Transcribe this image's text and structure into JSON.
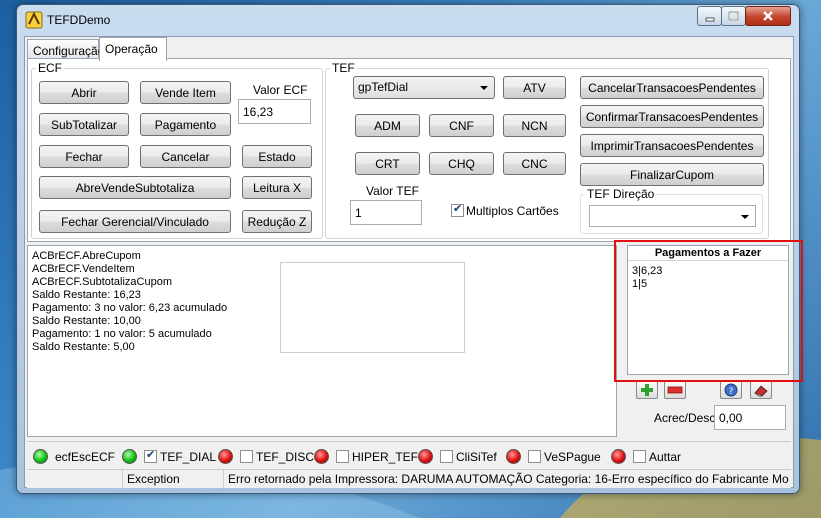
{
  "window": {
    "title": "TEFDDemo"
  },
  "tabs": [
    {
      "label": "Configuração"
    },
    {
      "label": "Operação"
    }
  ],
  "ecf": {
    "group_label": "ECF",
    "buttons": {
      "abrir": "Abrir",
      "vende_item": "Vende Item",
      "subtotalizar": "SubTotalizar",
      "pagamento": "Pagamento",
      "fechar": "Fechar",
      "cancelar": "Cancelar",
      "estado": "Estado",
      "abre_vende_subtotaliza": "AbreVendeSubtotaliza",
      "leitura_x": "Leitura X",
      "fechar_gerencial": "Fechar Gerencial/Vinculado",
      "reducao_z": "Redução Z"
    },
    "valor_label": "Valor ECF",
    "valor_value": "16,23"
  },
  "tef": {
    "group_label": "TEF",
    "gp_selected": "gpTefDial",
    "buttons": {
      "atv": "ATV",
      "adm": "ADM",
      "cnf": "CNF",
      "ncn": "NCN",
      "crt": "CRT",
      "chq": "CHQ",
      "cnc": "CNC",
      "cancelar_pendentes": "CancelarTransacoesPendentes",
      "confirmar_pendentes": "ConfirmarTransacoesPendentes",
      "imprimir_pendentes": "ImprimirTransacoesPendentes",
      "finalizar_cupom": "FinalizarCupom"
    },
    "valor_label": "Valor TEF",
    "valor_value": "1",
    "multiplos_label": "Multiplos Cartões",
    "multiplos_checked": true,
    "direcao_label": "TEF Direção",
    "direcao_value": ""
  },
  "log": {
    "lines": [
      "ACBrECF.AbreCupom",
      "ACBrECF.VendeItem",
      "ACBrECF.SubtotalizaCupom",
      "Saldo Restante: 16,23",
      "Pagamento: 3 no valor: 6,23 acumulado",
      "Saldo Restante: 10,00",
      "Pagamento: 1 no valor: 5 acumulado",
      "Saldo Restante: 5,00"
    ]
  },
  "pagamentos": {
    "header": "Pagamentos a Fazer",
    "items": [
      "3|6,23",
      "1|5"
    ],
    "acrec_label": "Acrec/Desc",
    "acrec_value": "0,00"
  },
  "status_indicators": [
    {
      "label": "ecfEscECF",
      "status": "green",
      "has_checkbox": false,
      "checked": false
    },
    {
      "label": "TEF_DIAL",
      "status": "green",
      "has_checkbox": true,
      "checked": true
    },
    {
      "label": "TEF_DISC",
      "status": "red",
      "has_checkbox": true,
      "checked": false
    },
    {
      "label": "HIPER_TEF",
      "status": "red",
      "has_checkbox": true,
      "checked": false
    },
    {
      "label": "CliSiTef",
      "status": "red",
      "has_checkbox": true,
      "checked": false
    },
    {
      "label": "VeSPague",
      "status": "red",
      "has_checkbox": true,
      "checked": false
    },
    {
      "label": "Auttar",
      "status": "red",
      "has_checkbox": true,
      "checked": false
    }
  ],
  "statusbar": {
    "cell1": "",
    "cell2": "Exception",
    "cell3": "Erro retornado pela Impressora: DARUMA AUTOMAÇÃO  Categoria: 16-Erro específico do Fabricante Mo"
  },
  "colors": {
    "highlight": "#e01010",
    "led_green": "#10c010",
    "led_red": "#e01010"
  }
}
